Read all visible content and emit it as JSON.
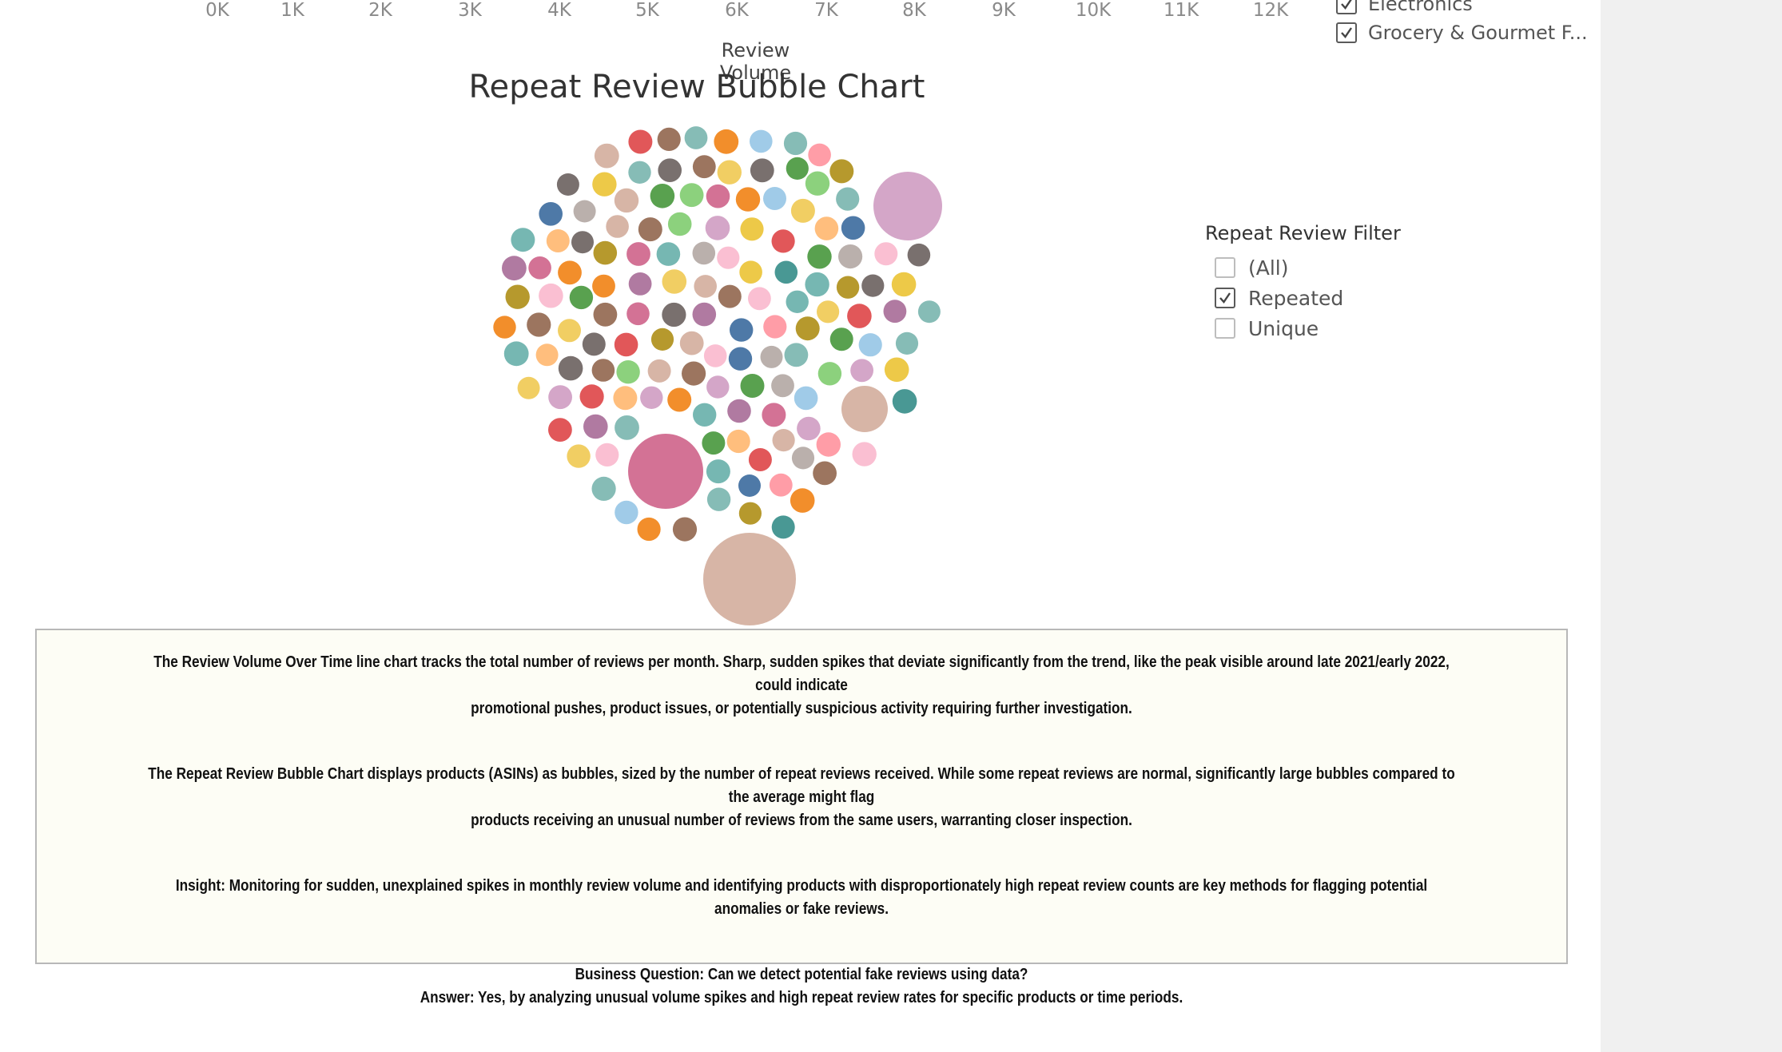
{
  "axis": {
    "ticks": [
      "0K",
      "1K",
      "2K",
      "3K",
      "4K",
      "5K",
      "6K",
      "7K",
      "8K",
      "9K",
      "10K",
      "11K",
      "12K"
    ],
    "title": "Review Volume"
  },
  "category_filter": {
    "items": [
      {
        "label": "Electronics",
        "checked": true
      },
      {
        "label": "Grocery & Gourmet F...",
        "checked": true
      }
    ]
  },
  "bubble_chart": {
    "title": "Repeat Review Bubble Chart",
    "palette": [
      "#4e79a7",
      "#f28e2b",
      "#e15759",
      "#76b7b2",
      "#59a14f",
      "#edc948",
      "#b07aa1",
      "#ff9da7",
      "#9c755f",
      "#bab0ac",
      "#a0cbe8",
      "#ffbe7d",
      "#8cd17d",
      "#b6992d",
      "#f1ce63",
      "#499894",
      "#86bcb6",
      "#d37295",
      "#fabfd2",
      "#d4a6c8",
      "#d7b5a6",
      "#79706e"
    ]
  },
  "repeat_filter": {
    "title": "Repeat Review Filter",
    "options": [
      {
        "label": "(All)",
        "checked": false
      },
      {
        "label": "Repeated",
        "checked": true
      },
      {
        "label": "Unique",
        "checked": false
      }
    ]
  },
  "notes": {
    "p1_line1": "The Review Volume Over Time line chart tracks the total number of reviews per month. Sharp, sudden spikes that deviate significantly from the trend, like the peak visible around late 2021/early 2022, could indicate",
    "p1_line2": "promotional pushes, product issues, or potentially suspicious activity requiring further investigation.",
    "p2_line1": "The Repeat Review Bubble Chart displays products (ASINs) as bubbles, sized by the number of repeat reviews received. While some repeat reviews are normal, significantly large bubbles compared to the average might flag",
    "p2_line2": "products receiving an unusual number of reviews from the same users, warranting closer inspection.",
    "p3": "Insight: Monitoring for sudden, unexplained spikes in monthly review volume and identifying products with disproportionately high repeat review counts are key methods for flagging potential anomalies or fake reviews.",
    "question": "Business Question: Can we detect potential fake reviews using data?",
    "answer": "Answer: Yes, by analyzing unusual volume spikes and high repeat review rates for specific products or time periods."
  }
}
